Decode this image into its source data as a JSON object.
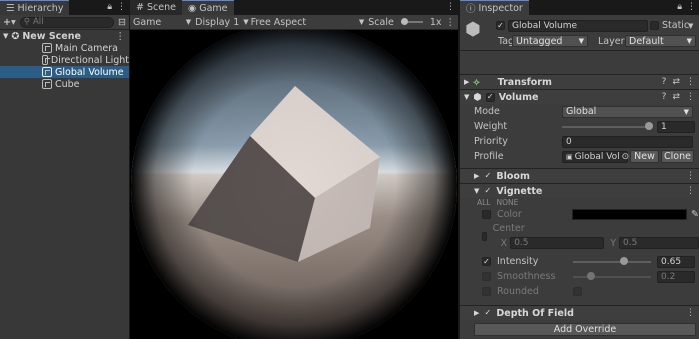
{
  "hierarchy": {
    "tab_label": "Hierarchy",
    "add_label": "+▾",
    "search_placeholder": "All",
    "scene_name": "New Scene",
    "items": [
      {
        "label": "Main Camera"
      },
      {
        "label": "Directional Light"
      },
      {
        "label": "Global Volume",
        "selected": true
      },
      {
        "label": "Cube"
      }
    ]
  },
  "game_view": {
    "tabs": [
      {
        "label": "Scene"
      },
      {
        "label": "Game"
      }
    ],
    "view_mode": "Game",
    "display": "Display 1",
    "aspect": "Free Aspect",
    "scale_label": "Scale",
    "scale_value": "1x"
  },
  "inspector": {
    "tab_label": "Inspector",
    "object_name": "Global Volume",
    "static_label": "Static",
    "tag_label": "Tag",
    "tag_value": "Untagged",
    "layer_label": "Layer",
    "layer_value": "Default",
    "transform_label": "Transform",
    "volume": {
      "label": "Volume",
      "mode_label": "Mode",
      "mode_value": "Global",
      "weight_label": "Weight",
      "weight_value": "1",
      "priority_label": "Priority",
      "priority_value": "0",
      "profile_label": "Profile",
      "profile_value": "Global Vol",
      "new_label": "New",
      "clone_label": "Clone"
    },
    "bloom_label": "Bloom",
    "vignette": {
      "label": "Vignette",
      "all_label": "ALL",
      "none_label": "NONE",
      "color_label": "Color",
      "color_value": "#000000",
      "center_label": "Center",
      "x_label": "X",
      "x_value": "0.5",
      "y_label": "Y",
      "y_value": "0.5",
      "intensity_label": "Intensity",
      "intensity_value": "0.65",
      "smoothness_label": "Smoothness",
      "smoothness_value": "0.2",
      "rounded_label": "Rounded"
    },
    "dof_label": "Depth Of Field",
    "add_override_label": "Add Override"
  }
}
